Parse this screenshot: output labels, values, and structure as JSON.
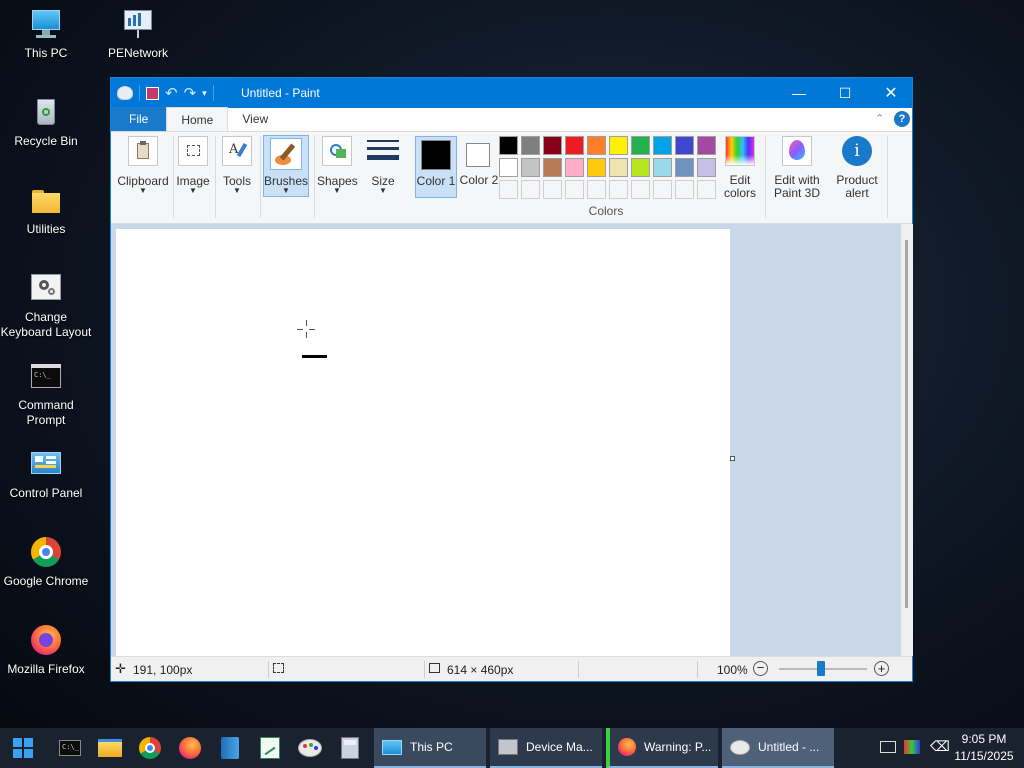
{
  "desktop": {
    "icons": [
      {
        "label": "This PC"
      },
      {
        "label": "PENetwork"
      },
      {
        "label": "Recycle Bin"
      },
      {
        "label": "Utilities"
      },
      {
        "label": "Change Keyboard Layout"
      },
      {
        "label": "Command Prompt"
      },
      {
        "label": "Control Panel"
      },
      {
        "label": "Google Chrome"
      },
      {
        "label": "Mozilla Firefox"
      }
    ]
  },
  "paint": {
    "title": "Untitled - Paint",
    "tabs": {
      "file": "File",
      "home": "Home",
      "view": "View"
    },
    "ribbon": {
      "clipboard": "Clipboard",
      "image": "Image",
      "tools": "Tools",
      "brushes": "Brushes",
      "shapes": "Shapes",
      "size": "Size",
      "color1": "Color 1",
      "color2": "Color 2",
      "colors_group": "Colors",
      "edit_colors": "Edit colors",
      "edit_paint3d": "Edit with Paint 3D",
      "product_alert": "Product alert"
    },
    "palette_row1": [
      "#000000",
      "#7f7f7f",
      "#880015",
      "#ed1c24",
      "#ff7f27",
      "#fff200",
      "#22b14c",
      "#00a2e8",
      "#3f48cc",
      "#a349a4"
    ],
    "palette_row2": [
      "#ffffff",
      "#c3c3c3",
      "#b97a57",
      "#ffaec9",
      "#ffc90e",
      "#efe4b0",
      "#b5e61d",
      "#99d9ea",
      "#7092be",
      "#c8bfe7"
    ],
    "color1_hex": "#000000",
    "color2_hex": "#ffffff",
    "status": {
      "cursor": "191, 100px",
      "size": "614 × 460px",
      "zoom": "100%"
    }
  },
  "taskbar": {
    "apps": [
      {
        "label": "This PC"
      },
      {
        "label": "Device Ma..."
      },
      {
        "label": "Warning: P..."
      },
      {
        "label": "Untitled - ..."
      }
    ],
    "time": "9:05 PM",
    "date": "11/15/2025"
  }
}
